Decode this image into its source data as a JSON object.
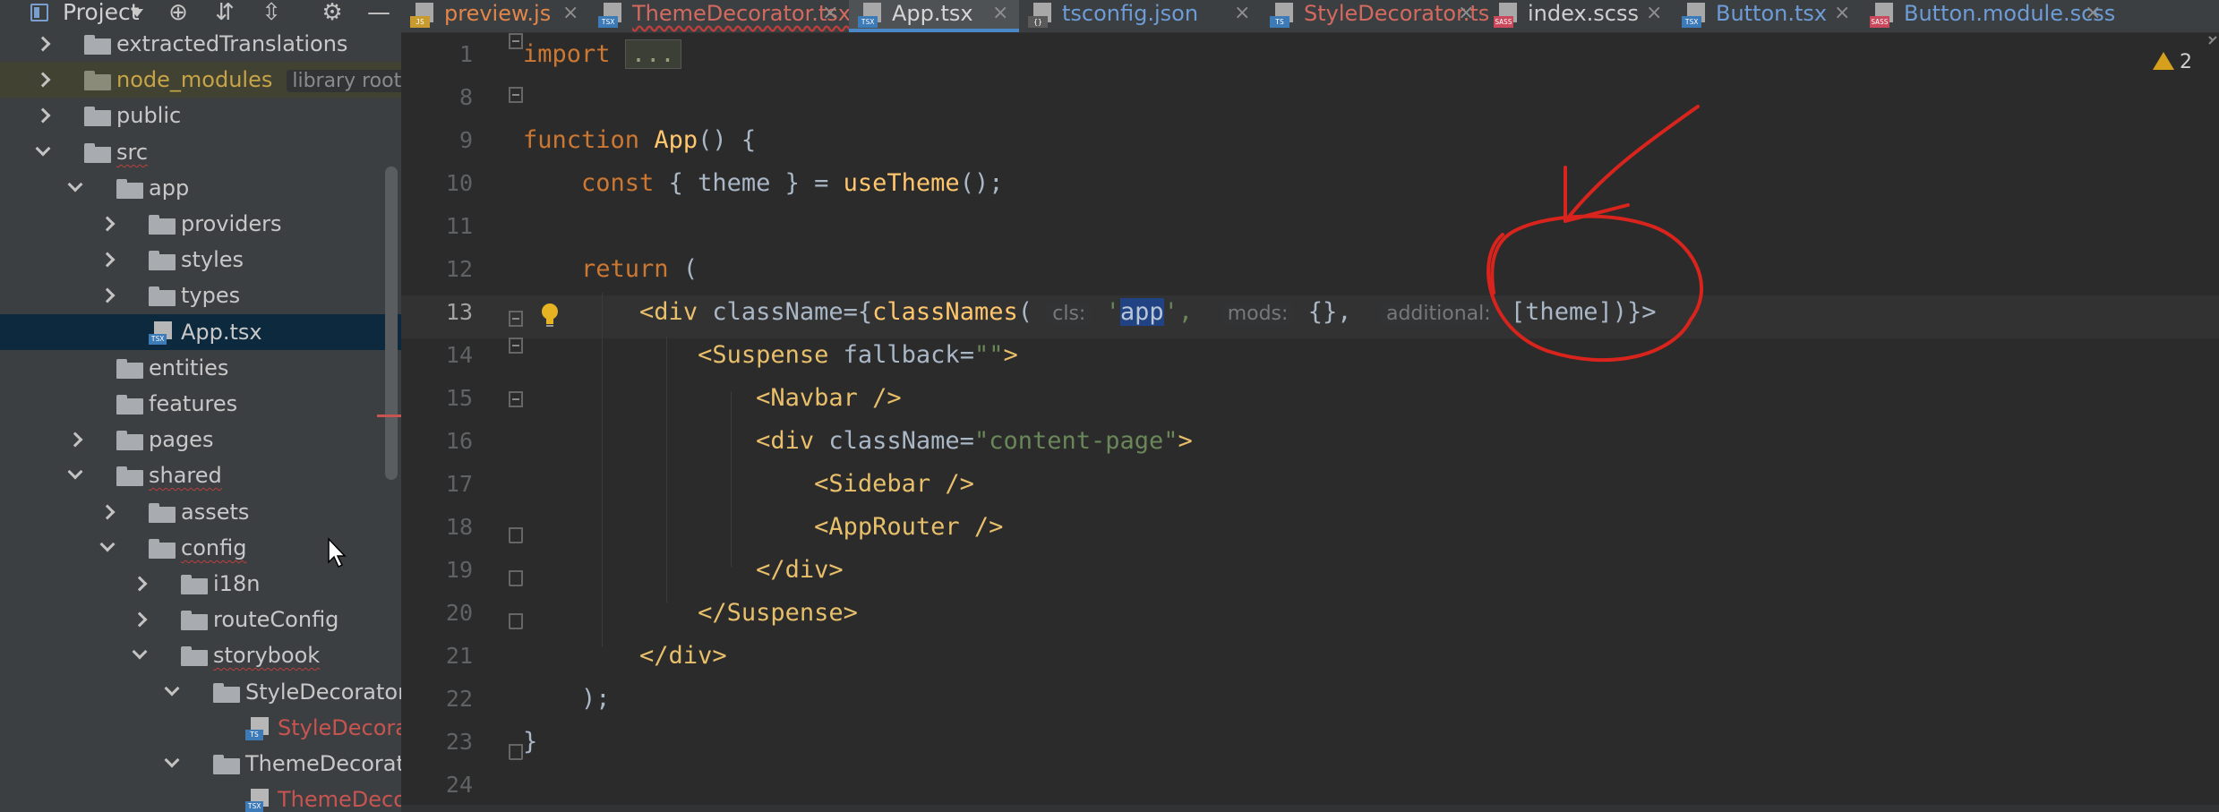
{
  "sidebar": {
    "title": "Project",
    "tree": [
      {
        "label": "extractedTranslations",
        "type": "folder",
        "indent": 0,
        "chevron": "right"
      },
      {
        "label": "node_modules",
        "hint": "library root",
        "type": "folder",
        "indent": 0,
        "chevron": "right",
        "style": "nm"
      },
      {
        "label": "public",
        "type": "folder",
        "indent": 0,
        "chevron": "right"
      },
      {
        "label": "src",
        "type": "folder",
        "indent": 0,
        "chevron": "down",
        "style": "ul"
      },
      {
        "label": "app",
        "type": "folder",
        "indent": 1,
        "chevron": "down"
      },
      {
        "label": "providers",
        "type": "folder",
        "indent": 2,
        "chevron": "right"
      },
      {
        "label": "styles",
        "type": "folder",
        "indent": 2,
        "chevron": "right"
      },
      {
        "label": "types",
        "type": "folder",
        "indent": 2,
        "chevron": "right"
      },
      {
        "label": "App.tsx",
        "type": "file",
        "ext": "TSX",
        "indent": 2,
        "chevron": "none",
        "selected": true
      },
      {
        "label": "entities",
        "type": "folder",
        "indent": 1,
        "chevron": "none"
      },
      {
        "label": "features",
        "type": "folder",
        "indent": 1,
        "chevron": "none"
      },
      {
        "label": "pages",
        "type": "folder",
        "indent": 1,
        "chevron": "right"
      },
      {
        "label": "shared",
        "type": "folder",
        "indent": 1,
        "chevron": "down",
        "style": "ul"
      },
      {
        "label": "assets",
        "type": "folder",
        "indent": 2,
        "chevron": "right"
      },
      {
        "label": "config",
        "type": "folder",
        "indent": 2,
        "chevron": "down",
        "style": "ul"
      },
      {
        "label": "i18n",
        "type": "folder",
        "indent": 3,
        "chevron": "right"
      },
      {
        "label": "routeConfig",
        "type": "folder",
        "indent": 3,
        "chevron": "right"
      },
      {
        "label": "storybook",
        "type": "folder",
        "indent": 3,
        "chevron": "down",
        "style": "ul"
      },
      {
        "label": "StyleDecorator",
        "type": "folder",
        "indent": 4,
        "chevron": "down"
      },
      {
        "label": "StyleDecorat",
        "type": "file",
        "ext": "TS",
        "indent": 5,
        "chevron": "none",
        "style": "err"
      },
      {
        "label": "ThemeDecorator",
        "type": "folder",
        "indent": 4,
        "chevron": "down"
      },
      {
        "label": "ThemeDecor",
        "type": "file",
        "ext": "TSX",
        "indent": 5,
        "chevron": "none",
        "style": "err"
      }
    ]
  },
  "tabs": [
    {
      "label": "preview.js",
      "ext": "JS",
      "color": "#e0864a",
      "active": false
    },
    {
      "label": "ThemeDecorator.tsx",
      "ext": "TSX",
      "color": "#d46a5f",
      "active": false,
      "wavy": true
    },
    {
      "label": "App.tsx",
      "ext": "TSX",
      "color": "#d5d5d5",
      "active": true
    },
    {
      "label": "tsconfig.json",
      "ext": "{}",
      "color": "#6d9cd6",
      "active": false
    },
    {
      "label": "StyleDecorator.ts",
      "ext": "TS",
      "color": "#d46a5f",
      "active": false
    },
    {
      "label": "index.scss",
      "ext": "SASS",
      "color": "#cfcfcf",
      "active": false
    },
    {
      "label": "Button.tsx",
      "ext": "TSX",
      "color": "#6d9cd6",
      "active": false
    },
    {
      "label": "Button.module.scss",
      "ext": "SASS",
      "color": "#6d9cd6",
      "active": false
    }
  ],
  "editor": {
    "warning_count": "2",
    "current_line": "13",
    "line_numbers": [
      "1",
      "8",
      "9",
      "10",
      "11",
      "12",
      "13",
      "14",
      "15",
      "16",
      "17",
      "18",
      "19",
      "20",
      "21",
      "22",
      "23",
      "24"
    ],
    "code": {
      "l1_kw": "import",
      "l1_collapsed": "...",
      "l9_kw": "function",
      "l9_fn": "App",
      "l9_rest": "() {",
      "l10_kw": "const",
      "l10_mid": " { theme } = ",
      "l10_fn": "useTheme",
      "l10_rest": "();",
      "l12_kw": "return",
      "l12_rest": " (",
      "l13_open": "<div",
      "l13_attr": " className={",
      "l13_fn": "classNames",
      "l13_paren": "(",
      "l13_hint_cls": "cls:",
      "l13_q1": "'",
      "l13_sel": "app",
      "l13_q2": "',",
      "l13_hint_mods": "mods:",
      "l13_mods": "{},",
      "l13_hint_add": "additional:",
      "l13_add": "[theme])}>",
      "l14_tag": "<Suspense",
      "l14_attr": " fallback=",
      "l14_str": "\"\"",
      "l14_end": ">",
      "l15_tag": "<Navbar />",
      "l16_tag": "<div",
      "l16_attr": " className=",
      "l16_str": "\"content-page\"",
      "l16_end": ">",
      "l17_tag": "<Sidebar />",
      "l18_tag": "<AppRouter />",
      "l19_tag": "</div>",
      "l20_tag": "</Suspense>",
      "l21_tag": "</div>",
      "l22": ");",
      "l23": "}"
    }
  },
  "colors": {
    "annotation": "#d8241c",
    "selection": "#214283",
    "keyword": "#cc7832",
    "function": "#ffc66d",
    "tag": "#e8bf6a",
    "string": "#6a8759"
  }
}
